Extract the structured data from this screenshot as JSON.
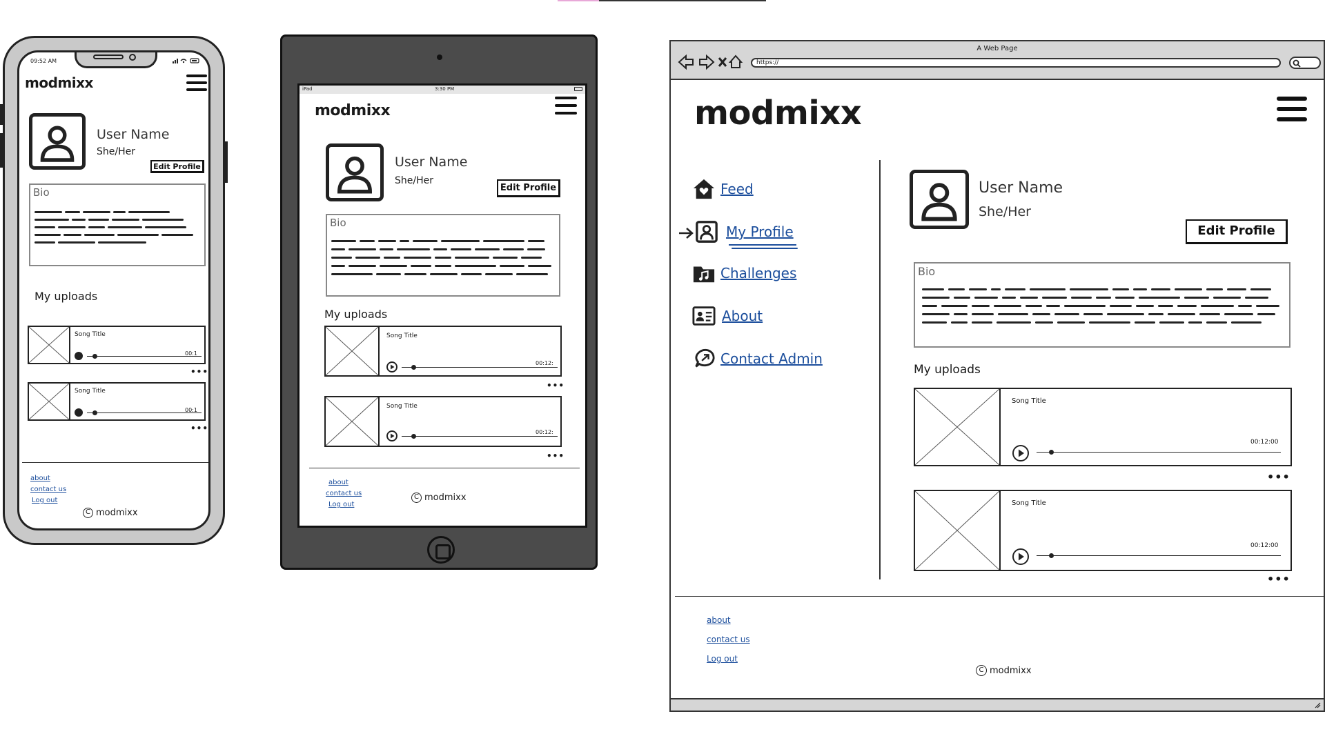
{
  "brand": "modmixx",
  "profile": {
    "user_name": "User Name",
    "pronouns": "She/Her",
    "edit_label": "Edit Profile",
    "bio_label": "Bio"
  },
  "uploads": {
    "heading": "My uploads",
    "songs": [
      {
        "title": "Song Title",
        "time": "00:12:00",
        "phone_time": "00:1",
        "tablet_time": "00:12:"
      },
      {
        "title": "Song Title",
        "time": "00:12:00",
        "phone_time": "00:1",
        "tablet_time": "00:12:"
      }
    ],
    "more": "•••"
  },
  "footer": {
    "about": "about",
    "contact": "contact us",
    "logout": "Log out",
    "copyright": "modmixx"
  },
  "phone": {
    "status_time": "09:52 AM"
  },
  "tablet": {
    "status_device": "iPad",
    "status_time": "3:30 PM"
  },
  "browser": {
    "window_title": "A Web Page",
    "url": "https://"
  },
  "nav": {
    "feed": "Feed",
    "my_profile": "My Profile",
    "challenges": "Challenges",
    "about": "About",
    "contact_admin": "Contact Admin"
  }
}
